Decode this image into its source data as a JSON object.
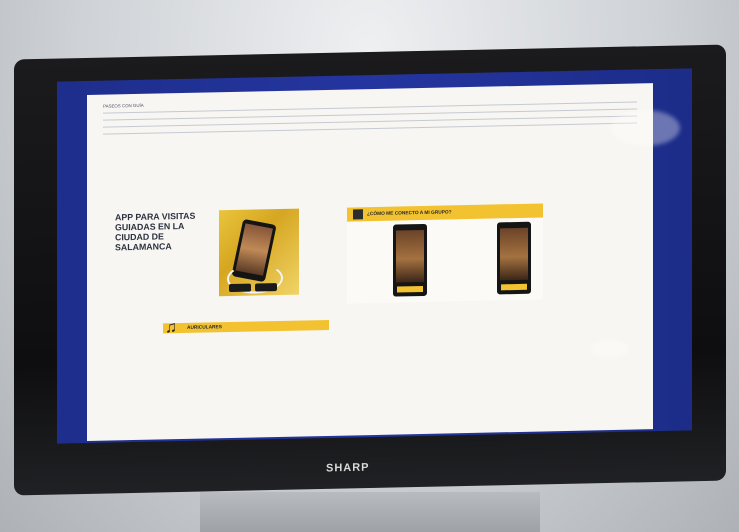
{
  "photo": {
    "brand": "SHARP",
    "screen_bg": "#2232a0",
    "accent": "#f2c230"
  },
  "doc": {
    "table_rows": [
      {
        "c1": "PASEOS CON GUÍA",
        "c2": "",
        "c3": "",
        "c4": "",
        "c5": ""
      },
      {
        "c1": "",
        "c2": "",
        "c3": "",
        "c4": "",
        "c5": ""
      },
      {
        "c1": "",
        "c2": "",
        "c3": "",
        "c4": "",
        "c5": ""
      },
      {
        "c1": "",
        "c2": "",
        "c3": "",
        "c4": "",
        "c5": ""
      }
    ],
    "app": {
      "title": "APP PARA VISITAS GUIADAS EN LA CIUDAD DE SALAMANCA"
    },
    "group": {
      "heading": "¿CÓMO ME CONECTO A MI GRUPO?"
    },
    "ear": {
      "heading": "AURICULARES"
    },
    "footer": {
      "line1": "",
      "line2": ""
    }
  }
}
